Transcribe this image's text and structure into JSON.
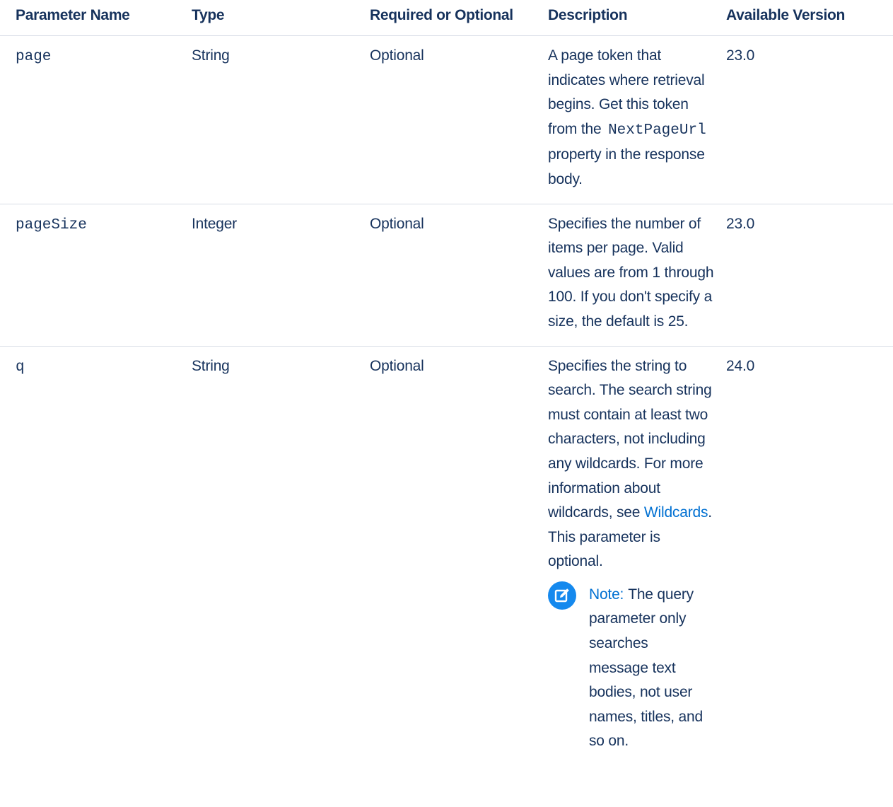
{
  "headers": {
    "name": "Parameter Name",
    "type": "Type",
    "required": "Required or Optional",
    "description": "Description",
    "version": "Available Version"
  },
  "rows": [
    {
      "name": "page",
      "type": "String",
      "required": "Optional",
      "desc_before": "A page token that indicates where retrieval begins. Get this token from the ",
      "desc_code": "NextPageUrl",
      "desc_after": "property in the response body.",
      "version": "23.0"
    },
    {
      "name": "pageSize",
      "type": "Integer",
      "required": "Optional",
      "desc": "Specifies the number of items per page. Valid values are from 1 through 100. If you don't specify a size, the default is 25.",
      "version": "23.0"
    },
    {
      "name": "q",
      "type": "String",
      "required": "Optional",
      "desc_before": "Specifies the string to search. The search string must contain at least two characters, not including any wildcards. For more information about wildcards, see ",
      "desc_link": "Wildcards",
      "desc_after": ". This parameter is optional.",
      "note_label": "Note:",
      "note_text": "The query parameter only searches message text bodies, not user names, titles, and so on.",
      "version": "24.0"
    }
  ],
  "icons": {
    "note": "note-edit-icon"
  },
  "colors": {
    "text": "#16325c",
    "link": "#0070d2",
    "note_icon_bg": "#1589ee",
    "divider": "#d8dde6"
  }
}
